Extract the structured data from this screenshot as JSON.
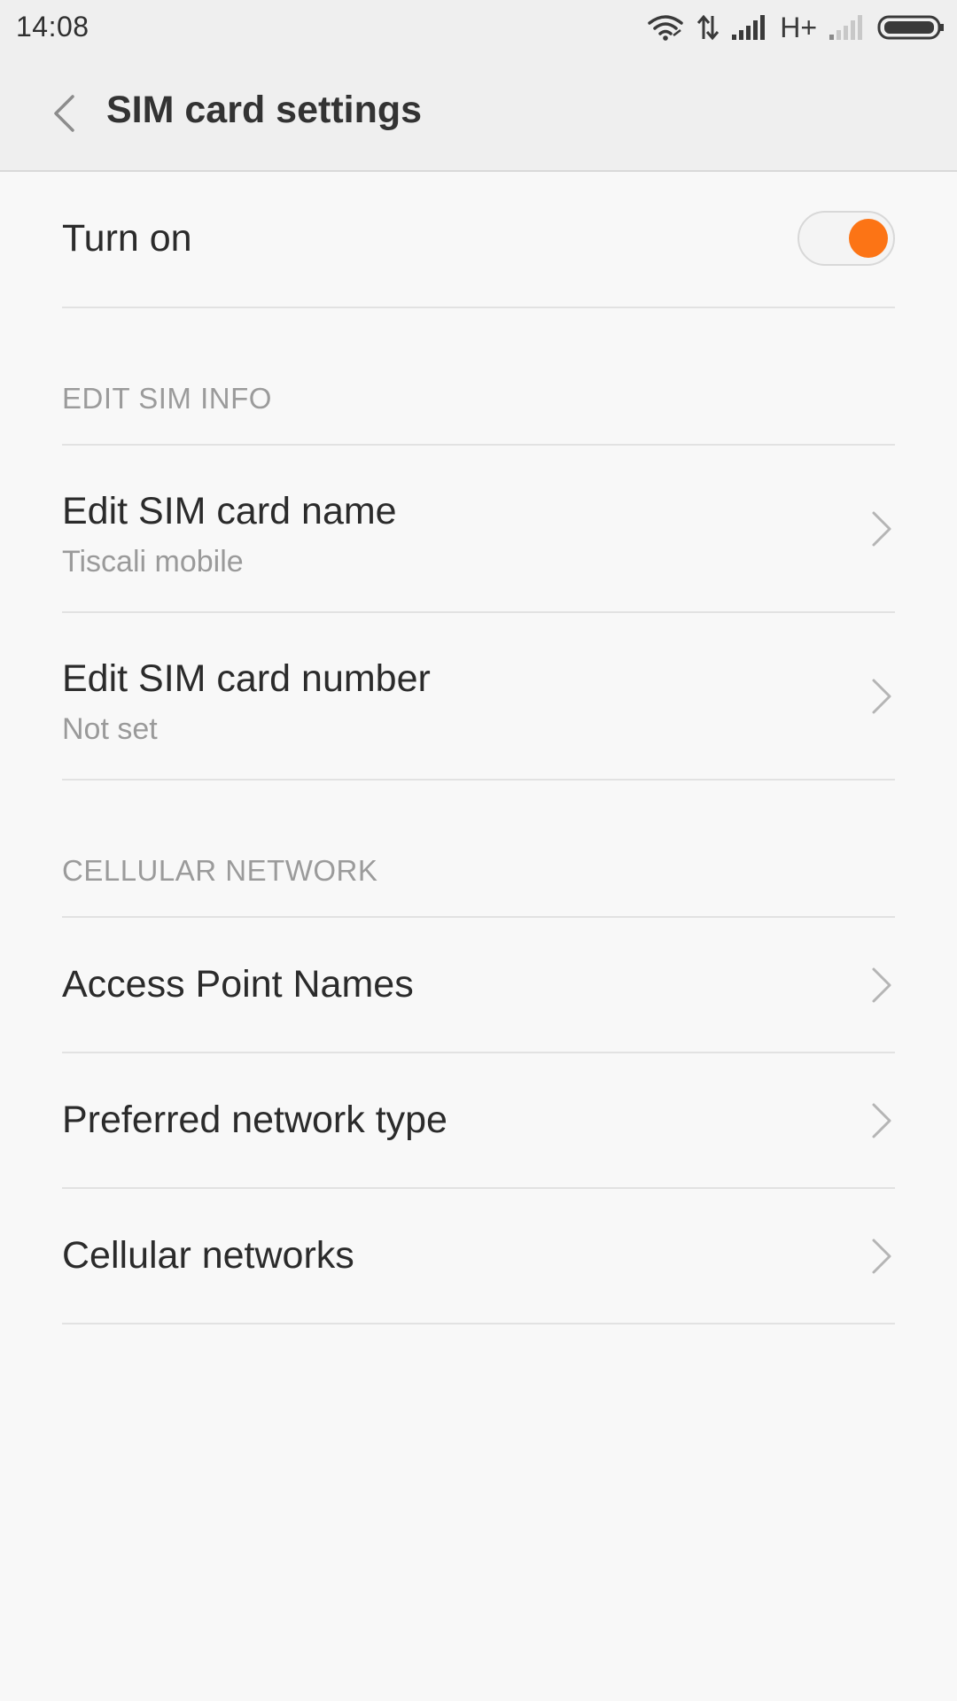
{
  "status_bar": {
    "time": "14:08",
    "network_type": "H+",
    "icons": [
      "wifi-icon",
      "data-transfer-icon",
      "signal-full-icon",
      "signal-weak-icon",
      "battery-icon"
    ]
  },
  "app_bar": {
    "title": "SIM card settings",
    "back_icon": "chevron-left-icon"
  },
  "toggle_row": {
    "label": "Turn on",
    "enabled": true
  },
  "sections": [
    {
      "header": "EDIT SIM INFO",
      "items": [
        {
          "title": "Edit SIM card name",
          "subtitle": "Tiscali mobile"
        },
        {
          "title": "Edit SIM card number",
          "subtitle": "Not set"
        }
      ]
    },
    {
      "header": "CELLULAR NETWORK",
      "items": [
        {
          "title": "Access Point Names"
        },
        {
          "title": "Preferred network type"
        },
        {
          "title": "Cellular networks"
        }
      ]
    }
  ],
  "colors": {
    "accent": "#fc7415",
    "background": "#f8f8f8",
    "bar_background": "#efefef",
    "divider": "#e2e2e2",
    "secondary_text": "#9a9a9a"
  }
}
